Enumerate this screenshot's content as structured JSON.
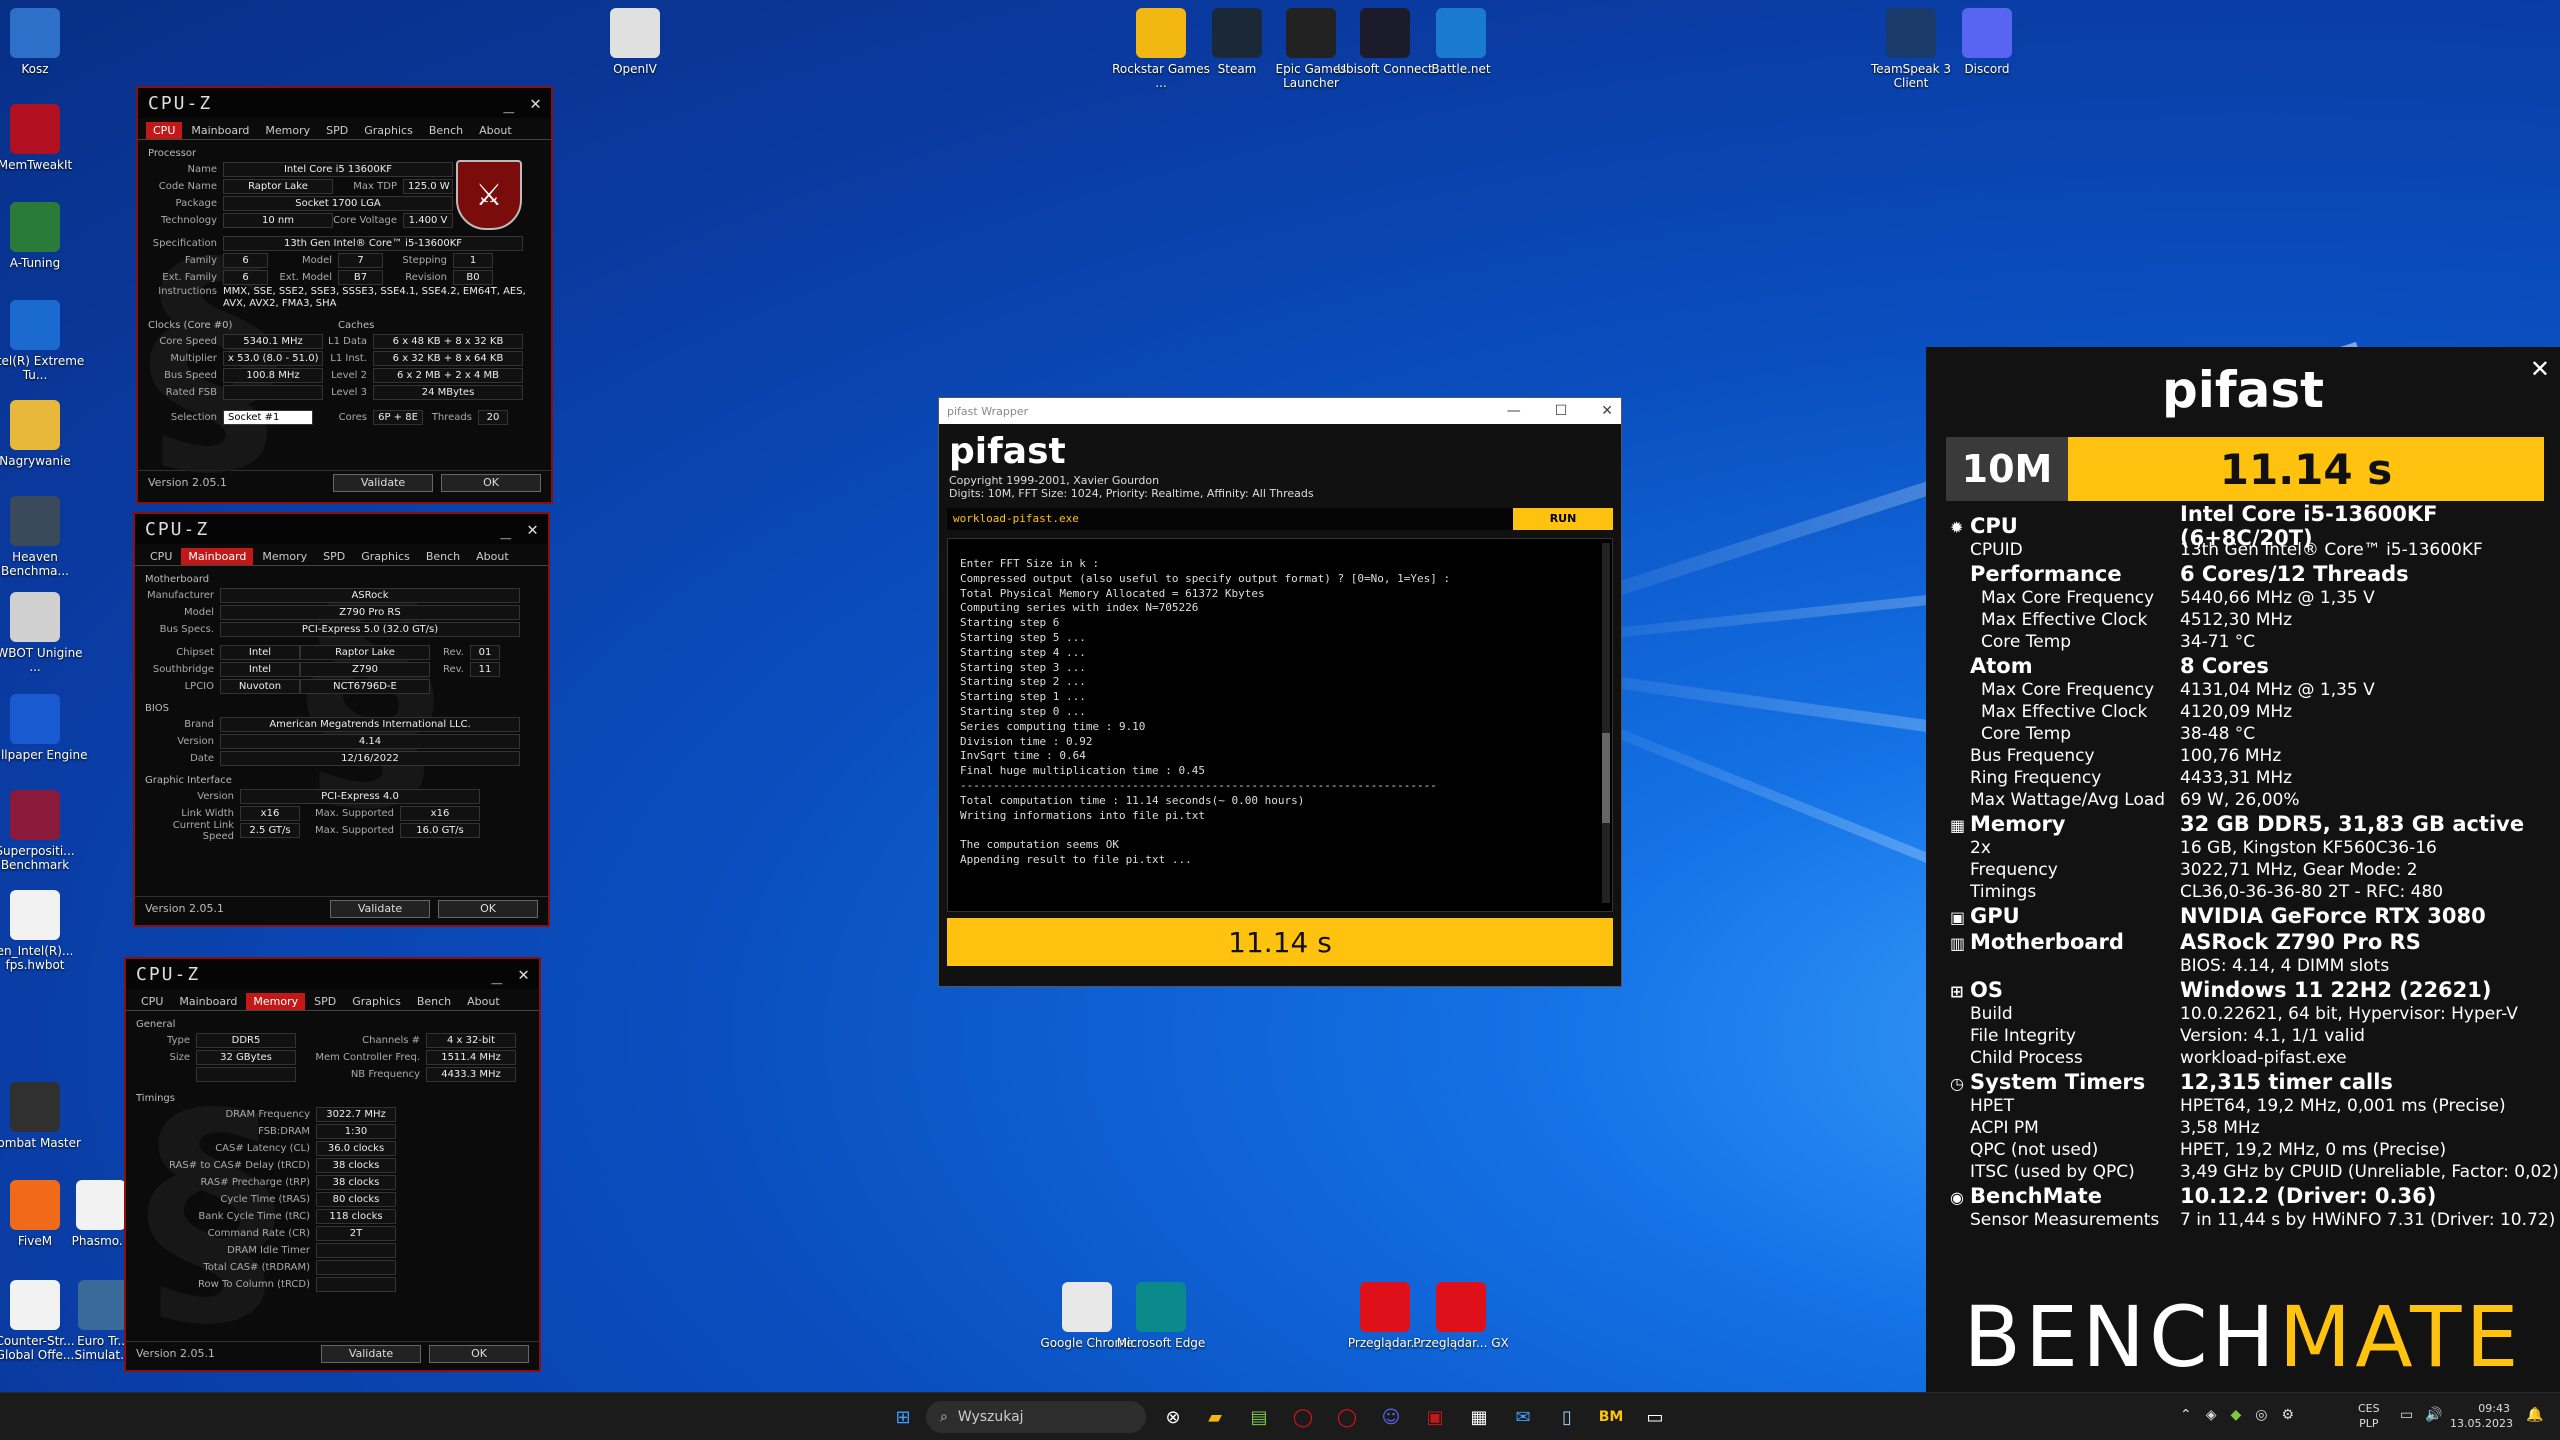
{
  "desktop_icons": [
    {
      "label": "Kosz",
      "icon": "recycle-bin-icon",
      "color": "#2d6fc9"
    },
    {
      "label": "MemTweakIt",
      "icon": "memtweakit-icon",
      "color": "#b01020"
    },
    {
      "label": "A-Tuning",
      "icon": "a-tuning-icon",
      "color": "#2a7a3a"
    },
    {
      "label": "Intel(R) Extreme Tu...",
      "icon": "intel-xtu-icon",
      "color": "#1a6ad0"
    },
    {
      "label": "Nagrywanie",
      "icon": "folder-icon",
      "color": "#e8b83a"
    },
    {
      "label": "Heaven Benchma...",
      "icon": "heaven-icon",
      "color": "#3a4a5a"
    },
    {
      "label": "HWBOT Unigine ...",
      "icon": "hwbot-icon",
      "color": "#d0d0d0"
    },
    {
      "label": "Wallpaper Engine",
      "icon": "wallpaper-engine-icon",
      "color": "#1a5ad0"
    },
    {
      "label": "Superpositi... Benchmark",
      "icon": "superposition-icon",
      "color": "#8a1a3a"
    },
    {
      "label": "en_Intel(R)... fps.hwbot",
      "icon": "file-icon",
      "color": "#f2f2f2"
    },
    {
      "label": "Combat Master",
      "icon": "combat-master-icon",
      "color": "#303030"
    },
    {
      "label": "FiveM",
      "icon": "fivem-icon",
      "color": "#f06a1a"
    },
    {
      "label": "Phasmo...",
      "icon": "phasmophobia-icon",
      "color": "#f2f2f2"
    },
    {
      "label": "Counter-Str... Global Offe...",
      "icon": "file-icon",
      "color": "#f2f2f2"
    },
    {
      "label": "Euro Tr... Simulat...",
      "icon": "ets-icon",
      "color": "#3a6a9a"
    },
    {
      "label": "OpenIV",
      "icon": "openiv-icon",
      "color": "#e0e0e0"
    },
    {
      "label": "Rockstar Games ...",
      "icon": "rockstar-icon",
      "color": "#f2b712"
    },
    {
      "label": "Steam",
      "icon": "steam-icon",
      "color": "#1b2838"
    },
    {
      "label": "Epic Games Launcher",
      "icon": "epic-icon",
      "color": "#222222"
    },
    {
      "label": "Ubisoft Connect",
      "icon": "ubisoft-icon",
      "color": "#1b1b2b"
    },
    {
      "label": "Battle.net",
      "icon": "battlenet-icon",
      "color": "#1a7ad0"
    },
    {
      "label": "TeamSpeak 3 Client",
      "icon": "teamspeak-icon",
      "color": "#1a3a6a"
    },
    {
      "label": "Discord",
      "icon": "discord-icon",
      "color": "#5865f2"
    },
    {
      "label": "Google Chrome",
      "icon": "chrome-icon",
      "color": "#e8e8e8"
    },
    {
      "label": "Microsoft Edge",
      "icon": "edge-icon",
      "color": "#0a8a8a"
    },
    {
      "label": "Przeglądar...",
      "icon": "opera-icon",
      "color": "#e0101a"
    },
    {
      "label": "Przeglądar... GX",
      "icon": "opera-gx-icon",
      "color": "#e0101a"
    }
  ],
  "cpuz_tabs": [
    "CPU",
    "Mainboard",
    "Memory",
    "SPD",
    "Graphics",
    "Bench",
    "About"
  ],
  "cpuz_common": {
    "title": "CPU-Z",
    "version": "Version 2.05.1",
    "validate": "Validate",
    "ok": "OK",
    "minimize": "_",
    "close": "✕"
  },
  "cpuz1": {
    "processor": "Processor",
    "rows": [
      {
        "l": "Name",
        "v": "Intel Core i5 13600KF"
      },
      {
        "l": "Code Name",
        "v": "Raptor Lake",
        "l2": "Max TDP",
        "v2": "125.0 W"
      },
      {
        "l": "Package",
        "v": "Socket 1700 LGA"
      },
      {
        "l": "Technology",
        "v": "10 nm",
        "l2": "Core Voltage",
        "v2": "1.400 V"
      }
    ],
    "spec_l": "Specification",
    "spec": "13th Gen Intel® Core™ i5-13600KF",
    "fam": [
      {
        "l": "Family",
        "v": "6",
        "l2": "Model",
        "v2": "7",
        "l3": "Stepping",
        "v3": "1"
      },
      {
        "l": "Ext. Family",
        "v": "6",
        "l2": "Ext. Model",
        "v2": "B7",
        "l3": "Revision",
        "v3": "B0"
      }
    ],
    "instr_l": "Instructions",
    "instr": "MMX, SSE, SSE2, SSE3, SSSE3, SSE4.1, SSE4.2, EM64T, AES, AVX, AVX2, FMA3, SHA",
    "clocks": "Clocks (Core #0)",
    "caches": "Caches",
    "clk": [
      {
        "l": "Core Speed",
        "v": "5340.1 MHz",
        "l2": "L1 Data",
        "v2": "6 x 48 KB + 8 x 32 KB"
      },
      {
        "l": "Multiplier",
        "v": "x 53.0 (8.0 - 51.0)",
        "l2": "L1 Inst.",
        "v2": "6 x 32 KB + 8 x 64 KB"
      },
      {
        "l": "Bus Speed",
        "v": "100.8 MHz",
        "l2": "Level 2",
        "v2": "6 x 2 MB + 2 x 4 MB"
      },
      {
        "l": "Rated FSB",
        "v": "",
        "l2": "Level 3",
        "v2": "24 MBytes"
      }
    ],
    "sel_l": "Selection",
    "sel": "Socket #1",
    "cores_l": "Cores",
    "cores": "6P + 8E",
    "threads_l": "Threads",
    "threads": "20"
  },
  "cpuz2": {
    "mb": "Motherboard",
    "rows": [
      {
        "l": "Manufacturer",
        "v": "ASRock"
      },
      {
        "l": "Model",
        "v": "Z790 Pro RS"
      },
      {
        "l": "Bus Specs.",
        "v": "PCI-Express 5.0 (32.0 GT/s)"
      }
    ],
    "chips": [
      {
        "l": "Chipset",
        "v": "Intel",
        "v2": "Raptor Lake",
        "l3": "Rev.",
        "v3": "01"
      },
      {
        "l": "Southbridge",
        "v": "Intel",
        "v2": "Z790",
        "l3": "Rev.",
        "v3": "11"
      },
      {
        "l": "LPCIO",
        "v": "Nuvoton",
        "v2": "NCT6796D-E"
      }
    ],
    "bios": "BIOS",
    "brows": [
      {
        "l": "Brand",
        "v": "American Megatrends International LLC."
      },
      {
        "l": "Version",
        "v": "4.14"
      },
      {
        "l": "Date",
        "v": "12/16/2022"
      }
    ],
    "gi": "Graphic Interface",
    "grows": [
      {
        "l": "Version",
        "v": "PCI-Express 4.0"
      },
      {
        "l": "Link Width",
        "v": "x16",
        "l2": "Max. Supported",
        "v2": "x16"
      },
      {
        "l": "Current Link Speed",
        "v": "2.5 GT/s",
        "l2": "Max. Supported",
        "v2": "16.0 GT/s"
      }
    ]
  },
  "cpuz3": {
    "general": "General",
    "g": [
      {
        "l": "Type",
        "v": "DDR5",
        "l2": "Channels #",
        "v2": "4 x 32-bit"
      },
      {
        "l": "Size",
        "v": "32 GBytes",
        "l2": "Mem Controller Freq.",
        "v2": "1511.4 MHz"
      },
      {
        "l": "",
        "v": "",
        "l2": "NB Frequency",
        "v2": "4433.3 MHz"
      }
    ],
    "timings": "Timings",
    "t": [
      {
        "l": "DRAM Frequency",
        "v": "3022.7 MHz"
      },
      {
        "l": "FSB:DRAM",
        "v": "1:30"
      },
      {
        "l": "CAS# Latency (CL)",
        "v": "36.0 clocks"
      },
      {
        "l": "RAS# to CAS# Delay (tRCD)",
        "v": "38 clocks"
      },
      {
        "l": "RAS# Precharge (tRP)",
        "v": "38 clocks"
      },
      {
        "l": "Cycle Time (tRAS)",
        "v": "80 clocks"
      },
      {
        "l": "Bank Cycle Time (tRC)",
        "v": "118 clocks"
      },
      {
        "l": "Command Rate (CR)",
        "v": "2T"
      },
      {
        "l": "DRAM Idle Timer",
        "v": ""
      },
      {
        "l": "Total CAS# (tRDRAM)",
        "v": ""
      },
      {
        "l": "Row To Column (tRCD)",
        "v": ""
      }
    ]
  },
  "pifast": {
    "window_title": "pifast Wrapper",
    "title": "pifast",
    "copyright": "Copyright 1999-2001, Xavier Gourdon",
    "params": "Digits: 10M, FFT Size: 1024, Priority: Realtime, Affinity: All Threads",
    "exe": "workload-pifast.exe",
    "run": "RUN",
    "console": [
      "Enter FFT Size in k :",
      "Compressed output (also useful to specify output format) ? [0=No, 1=Yes] :",
      "Total Physical Memory Allocated = 61372 Kbytes",
      "Computing series with index N=705226",
      "Starting step 6",
      "Starting step 5 ...",
      "Starting step 4 ...",
      "Starting step 3 ...",
      "Starting step 2 ...",
      "Starting step 1 ...",
      "Starting step 0 ...",
      "Series computing time : 9.10",
      "Division time : 0.92",
      "InvSqrt time : 0.64",
      "Final huge multiplication time : 0.45",
      "------------------------------------------------------------------------",
      "Total computation time : 11.14 seconds(~ 0.00 hours)",
      "Writing informations into file pi.txt",
      "",
      "The computation seems OK",
      "Appending result to file pi.txt ..."
    ],
    "result": "11.14 s"
  },
  "bench": {
    "title": "pifast",
    "size": "10M",
    "score": "11.14 s",
    "accent": "#ffc20e",
    "rows": [
      {
        "k": "CPU",
        "v": "Intel Core i5-13600KF (6+8C/20T)",
        "h": true,
        "icon": "cpu-icon",
        "sym": "✹"
      },
      {
        "k": "CPUID",
        "v": "13th Gen Intel® Core™ i5-13600KF"
      },
      {
        "k": "Performance",
        "v": "6 Cores/12 Threads",
        "h": true
      },
      {
        "k": "Max Core Frequency",
        "v": "5440,66 MHz @ 1,35 V",
        "ind": true
      },
      {
        "k": "Max Effective Clock",
        "v": "4512,30 MHz",
        "ind": true
      },
      {
        "k": "Core Temp",
        "v": "34-71 °C",
        "ind": true
      },
      {
        "k": "Atom",
        "v": "8 Cores",
        "h": true
      },
      {
        "k": "Max Core Frequency",
        "v": "4131,04 MHz @ 1,35 V",
        "ind": true
      },
      {
        "k": "Max Effective Clock",
        "v": "4120,09 MHz",
        "ind": true
      },
      {
        "k": "Core Temp",
        "v": "38-48 °C",
        "ind": true
      },
      {
        "k": "Bus Frequency",
        "v": "100,76 MHz"
      },
      {
        "k": "Ring Frequency",
        "v": "4433,31 MHz"
      },
      {
        "k": "Max Wattage/Avg Load",
        "v": "69 W, 26,00%"
      },
      {
        "k": "Memory",
        "v": "32 GB DDR5, 31,83 GB active",
        "h": true,
        "icon": "memory-icon",
        "sym": "▦"
      },
      {
        "k": "2x",
        "v": "16 GB, Kingston KF560C36-16"
      },
      {
        "k": "Frequency",
        "v": "3022,71 MHz, Gear Mode: 2"
      },
      {
        "k": "Timings",
        "v": "CL36,0-36-36-80 2T - RFC: 480"
      },
      {
        "k": "GPU",
        "v": "NVIDIA GeForce RTX 3080",
        "h": true,
        "icon": "gpu-icon",
        "sym": "▣"
      },
      {
        "k": "Motherboard",
        "v": "ASRock Z790 Pro RS",
        "h": true,
        "icon": "motherboard-icon",
        "sym": "▥"
      },
      {
        "k": "",
        "v": "BIOS: 4.14, 4 DIMM slots"
      },
      {
        "k": "OS",
        "v": "Windows 11 22H2 (22621)",
        "h": true,
        "icon": "windows-icon",
        "sym": "⊞"
      },
      {
        "k": "Build",
        "v": "10.0.22621, 64 bit, Hypervisor: Hyper-V"
      },
      {
        "k": "File Integrity",
        "v": "Version: 4.1, 1/1 valid"
      },
      {
        "k": "Child Process",
        "v": "workload-pifast.exe"
      },
      {
        "k": "System Timers",
        "v": "12,315 timer calls",
        "h": true,
        "icon": "timer-icon",
        "sym": "◷"
      },
      {
        "k": "HPET",
        "v": "HPET64, 19,2 MHz, 0,001 ms (Precise)"
      },
      {
        "k": "ACPI PM",
        "v": "3,58 MHz"
      },
      {
        "k": "QPC (not used)",
        "v": "HPET, 19,2 MHz, 0 ms (Precise)"
      },
      {
        "k": "ITSC (used by QPC)",
        "v": "3,49 GHz by CPUID (Unreliable, Factor: 0,02)"
      },
      {
        "k": "BenchMate",
        "v": "10.12.2 (Driver: 0.36)",
        "h": true,
        "icon": "benchmate-icon",
        "sym": "◉"
      },
      {
        "k": "Sensor Measurements",
        "v": "7 in 11,44 s by HWiNFO 7.31 (Driver: 10.72)"
      }
    ],
    "logo_a": "BENCH",
    "logo_b": "MATE"
  },
  "taskbar": {
    "search": "Wyszukaj",
    "lang": "CES",
    "kb": "PLP",
    "time": "09:43",
    "date": "13.05.2023"
  }
}
